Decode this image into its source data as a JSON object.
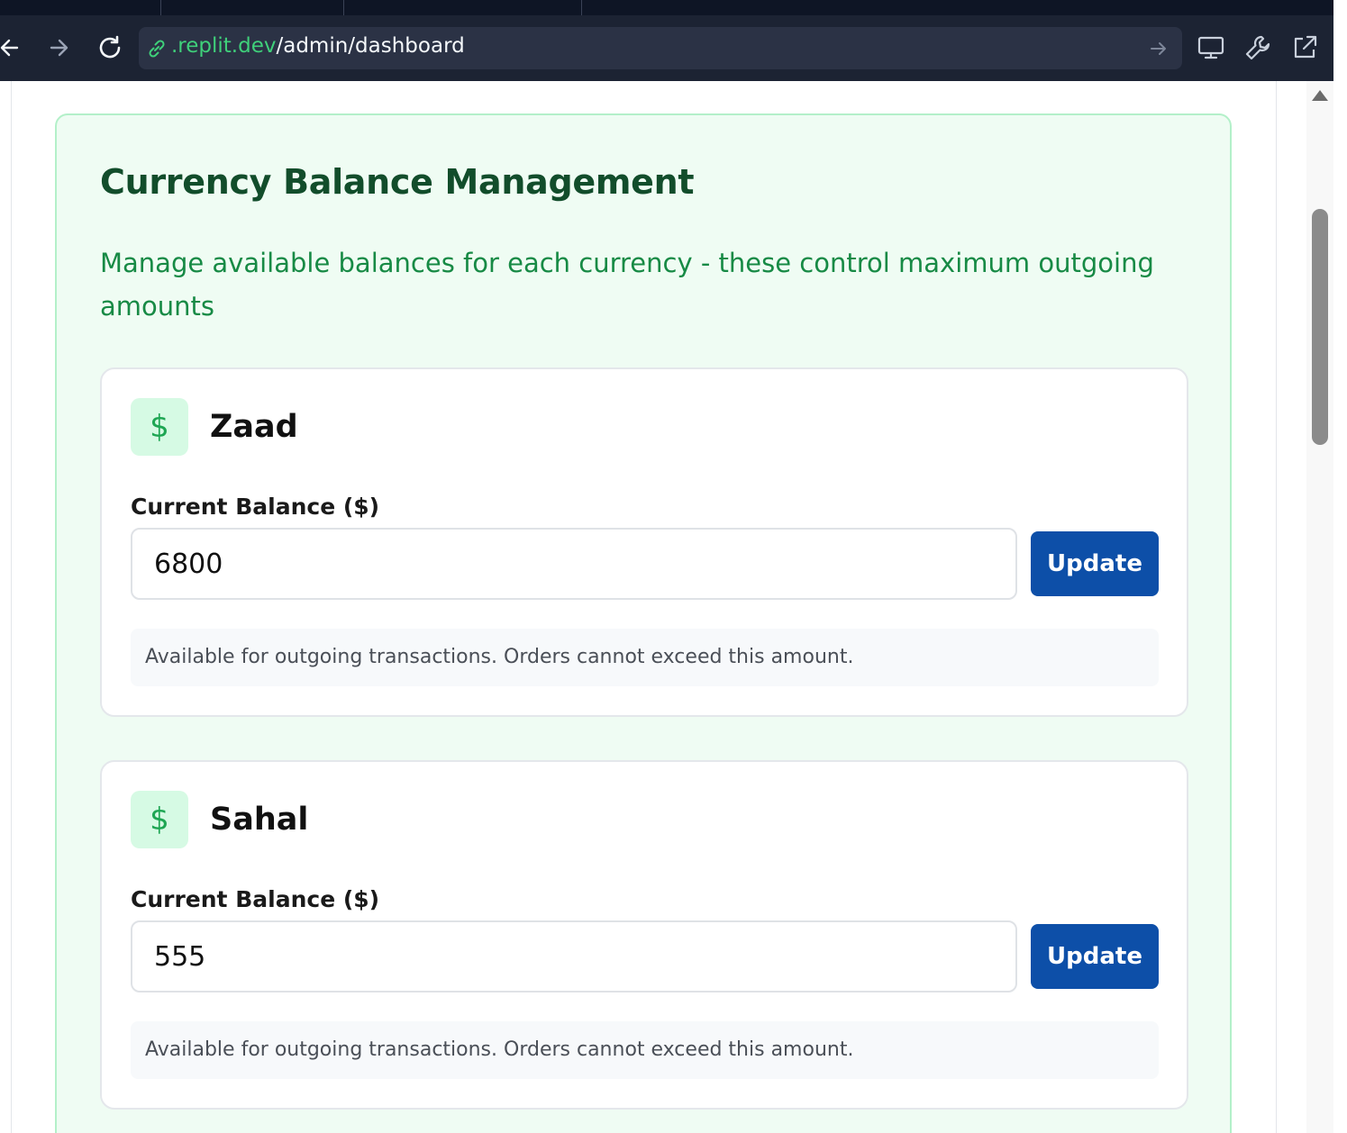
{
  "browser": {
    "url_host": ".replit.dev",
    "url_path": "/admin/dashboard",
    "icons": [
      "back-arrow-icon",
      "forward-arrow-icon",
      "reload-icon",
      "link-icon",
      "go-arrow-icon",
      "monitor-icon",
      "wrench-icon",
      "external-link-icon"
    ]
  },
  "panel": {
    "title": "Currency Balance Management",
    "description": "Manage available balances for each currency - these control maximum outgoing amounts",
    "accent": "#1ea653",
    "background": "#effcf3"
  },
  "currencies": [
    {
      "icon_glyph": "$",
      "name": "Zaad",
      "label": "Current Balance ($)",
      "value": "6800",
      "button": "Update",
      "note": "Available for outgoing transactions. Orders cannot exceed this amount."
    },
    {
      "icon_glyph": "$",
      "name": "Sahal",
      "label": "Current Balance ($)",
      "value": "555",
      "button": "Update",
      "note": "Available for outgoing transactions. Orders cannot exceed this amount."
    }
  ],
  "colors": {
    "button": "#0d4fa8",
    "title": "#124d2b",
    "description": "#178a45"
  }
}
